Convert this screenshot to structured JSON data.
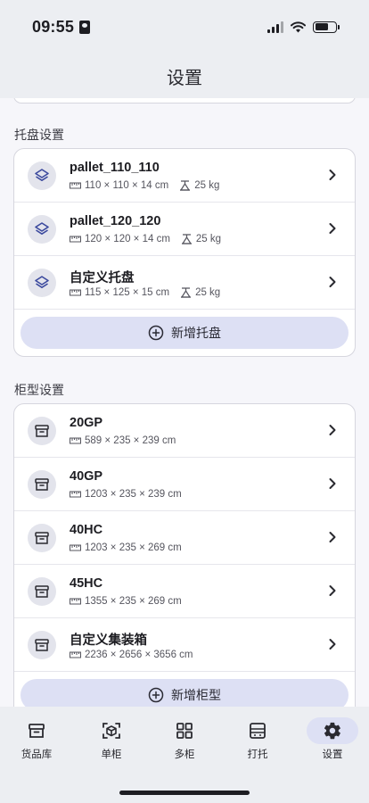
{
  "status_bar": {
    "time": "09:55"
  },
  "header": {
    "title": "设置"
  },
  "pallet_section": {
    "label": "托盘设置",
    "items": [
      {
        "name": "pallet_110_110",
        "dims": "110 × 110 × 14 cm",
        "weight": "25 kg"
      },
      {
        "name": "pallet_120_120",
        "dims": "120 × 120 × 14 cm",
        "weight": "25 kg"
      },
      {
        "name": "自定义托盘",
        "dims": "115 × 125 × 15 cm",
        "weight": "25 kg"
      }
    ],
    "add_label": "新增托盘"
  },
  "container_section": {
    "label": "柜型设置",
    "items": [
      {
        "name": "20GP",
        "dims": "589 × 235 × 239 cm"
      },
      {
        "name": "40GP",
        "dims": "1203 × 235 × 239 cm"
      },
      {
        "name": "40HC",
        "dims": "1203 × 235 × 269 cm"
      },
      {
        "name": "45HC",
        "dims": "1355 × 235 × 269 cm"
      },
      {
        "name": "自定义集装箱",
        "dims": "2236 × 2656 × 3656 cm"
      }
    ],
    "add_label": "新增柜型"
  },
  "tabs": [
    {
      "label": "货品库",
      "icon": "archive-icon"
    },
    {
      "label": "单柜",
      "icon": "cube-scan-icon"
    },
    {
      "label": "多柜",
      "icon": "grid-icon"
    },
    {
      "label": "打托",
      "icon": "pallet-stack-icon"
    },
    {
      "label": "设置",
      "icon": "gear-icon",
      "active": true
    }
  ],
  "colors": {
    "accent": "#dde0f4",
    "background": "#f6f6fa",
    "bar": "#eceef2"
  }
}
